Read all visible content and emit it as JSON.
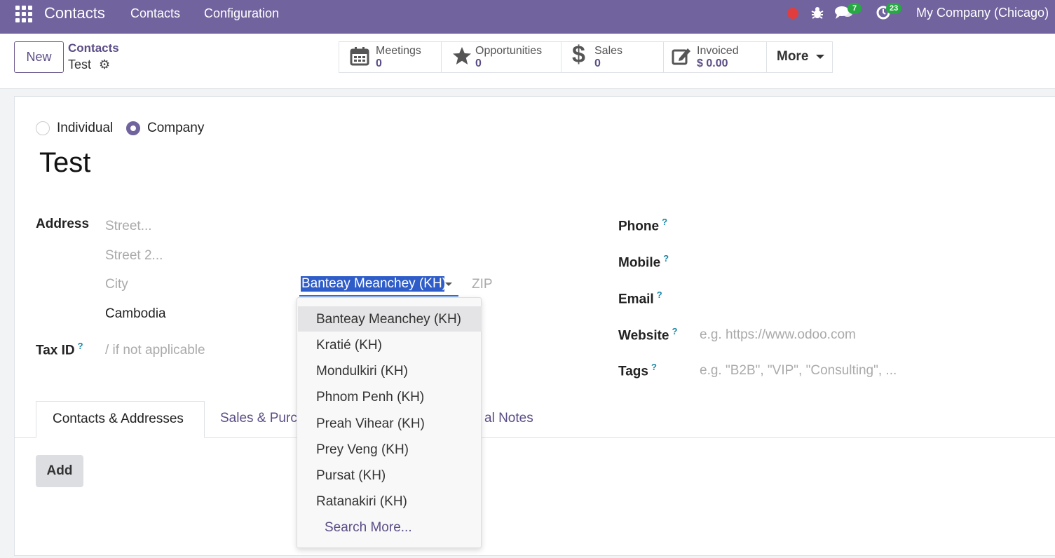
{
  "navbar": {
    "app_name": "Contacts",
    "menus": [
      "Contacts",
      "Configuration"
    ],
    "messages_count": "7",
    "activities_count": "23",
    "company": "My Company (Chicago)"
  },
  "control_panel": {
    "new_label": "New",
    "breadcrumb_parent": "Contacts",
    "breadcrumb_current": "Test",
    "smart_buttons": [
      {
        "label": "Meetings",
        "value": "0",
        "icon": "calendar-icon"
      },
      {
        "label": "Opportunities",
        "value": "0",
        "icon": "star-icon"
      },
      {
        "label": "Sales",
        "value": "0",
        "icon": "dollar-icon"
      },
      {
        "label": "Invoiced",
        "value": "$ 0.00",
        "icon": "edit-icon"
      }
    ],
    "more_label": "More"
  },
  "form": {
    "type_options": [
      "Individual",
      "Company"
    ],
    "selected_type": "Company",
    "name": "Test",
    "address_label": "Address",
    "street_placeholder": "Street...",
    "street2_placeholder": "Street 2...",
    "city_placeholder": "City",
    "state_value": "Banteay Meanchey (KH)",
    "zip_placeholder": "ZIP",
    "country_value": "Cambodia",
    "tax_id_label": "Tax ID",
    "tax_id_placeholder": "/ if not applicable",
    "help_mark": "?",
    "phone_label": "Phone",
    "mobile_label": "Mobile",
    "email_label": "Email",
    "website_label": "Website",
    "website_placeholder": "e.g. https://www.odoo.com",
    "tags_label": "Tags",
    "tags_placeholder": "e.g. \"B2B\", \"VIP\", \"Consulting\", ..."
  },
  "tabs": {
    "active": "Contacts & Addresses",
    "tab2_visible": "Sales & Purc",
    "tab3_visible": "al Notes",
    "add_label": "Add"
  },
  "dropdown": {
    "items": [
      "Banteay Meanchey (KH)",
      "Kratié (KH)",
      "Mondulkiri (KH)",
      "Phnom Penh (KH)",
      "Preah Vihear (KH)",
      "Prey Veng (KH)",
      "Pursat (KH)",
      "Ratanakiri (KH)"
    ],
    "search_more": "Search More..."
  },
  "colors": {
    "navbar": "#71639e",
    "accent_text": "#5b4d86",
    "selection": "#2e5cc9",
    "badge": "#28a745",
    "recording": "#e03e3e"
  }
}
